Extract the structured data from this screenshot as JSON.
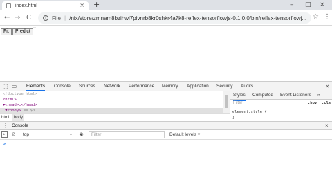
{
  "browser": {
    "tab_title": "index.html",
    "new_tab_glyph": "+",
    "tab_close_glyph": "×",
    "window_controls": [
      "–",
      "□",
      "×"
    ],
    "nav": {
      "back": "←",
      "forward": "→",
      "reload": "C"
    },
    "omnibox": {
      "info_glyph": "i",
      "scheme_label": "File",
      "separator": "|",
      "url": "/nix/store/zmnam8bzihwl7pivnrb8kr0shkr4a7k8-reflex-tensorflowjs-0.1.0.0/bin/reflex-tensorflowj..."
    },
    "star_glyph": "☆",
    "menu_glyph": "⋮"
  },
  "page": {
    "buttons": {
      "fit": "Fit",
      "predict": "Predict"
    },
    "extra_text": "\"\""
  },
  "devtools": {
    "tabs": [
      "Elements",
      "Console",
      "Sources",
      "Network",
      "Performance",
      "Memory",
      "Application",
      "Security",
      "Audits"
    ],
    "active_tab": "Elements",
    "close_glyph": "×",
    "elements": {
      "doctype": "<!doctype html>",
      "html": "<html>",
      "head": "▶<head>…</head>",
      "body_prefix": "…▼<body>",
      "body_suffix": "== $0"
    },
    "breadcrumbs": [
      "html",
      "body"
    ],
    "styles_tabs": [
      "Styles",
      "Computed",
      "Event Listeners",
      "»"
    ],
    "filter_placeholder": "Filter",
    "hov": ":hov",
    "cls": ".cls",
    "style_rule_line1": "element.style {",
    "style_rule_line2": "}",
    "drawer": {
      "menu_glyph": "⋮",
      "tab": "Console",
      "close_glyph": "×"
    },
    "console_toolbar": {
      "sidebar_glyph": "▸",
      "clear_glyph": "⊘",
      "context": "top",
      "context_caret": "▼",
      "eye_glyph": "◉",
      "filter_placeholder": "Filter",
      "levels": "Default levels ▾"
    },
    "prompt_glyph": ">"
  }
}
